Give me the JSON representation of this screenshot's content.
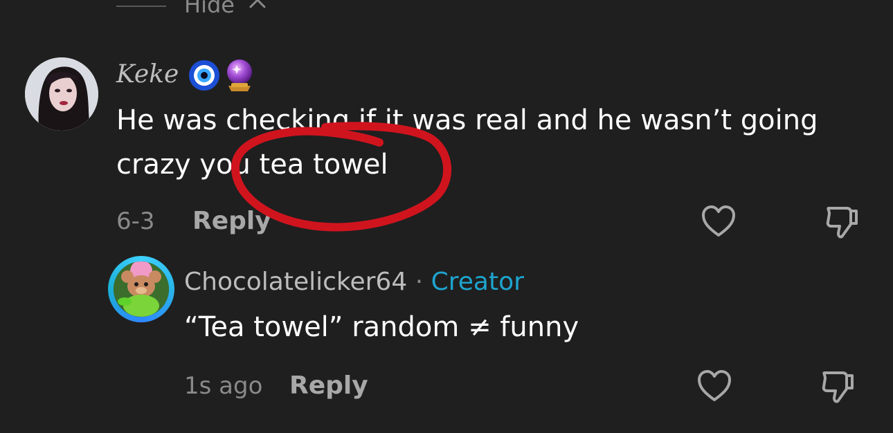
{
  "thread": {
    "hide_label": "Hide"
  },
  "comments": [
    {
      "username": "Keke",
      "badges": [
        "nazar-amulet-emoji",
        "crystal-ball-emoji"
      ],
      "text": "He was checking if it was real and he wasn’t going crazy you tea towel",
      "date": "6-3",
      "reply_label": "Reply"
    },
    {
      "username": "Chocolatelicker64",
      "separator": "·",
      "role": "Creator",
      "text": "“Tea towel” random ≠ funny",
      "date": "1s ago",
      "reply_label": "Reply"
    }
  ],
  "colors": {
    "background": "#1f1f1f",
    "creator_accent": "#1da5cf",
    "annotation_red": "#d0141e",
    "muted_text": "#8a8a8a"
  }
}
